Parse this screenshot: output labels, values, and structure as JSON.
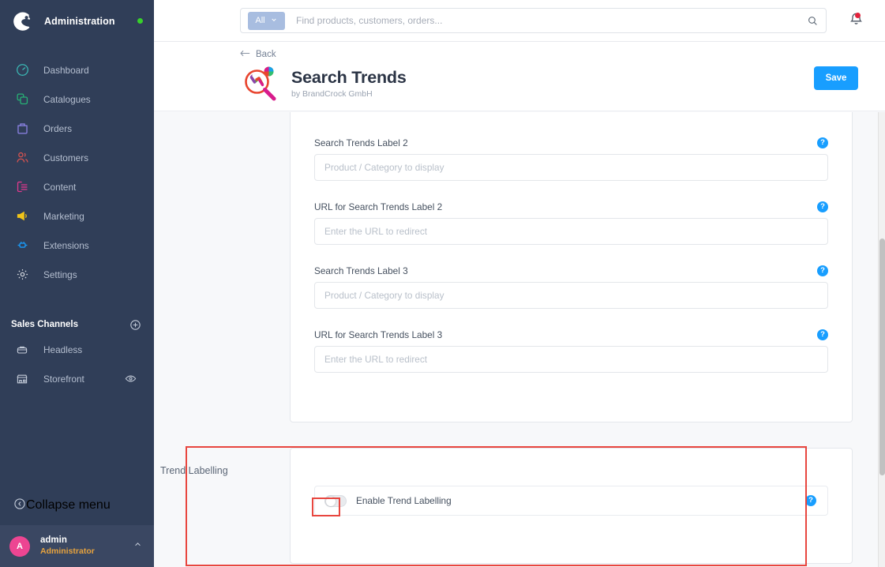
{
  "sidebar": {
    "brand": {
      "title": "Administration",
      "logo_icon": "shopware-logo-icon",
      "status_dot": "online-dot"
    },
    "items": [
      {
        "label": "Dashboard",
        "icon": "speedometer-icon",
        "color": "#3bb6b3"
      },
      {
        "label": "Catalogues",
        "icon": "layers-icon",
        "color": "#27b376"
      },
      {
        "label": "Orders",
        "icon": "bag-icon",
        "color": "#8e84e8"
      },
      {
        "label": "Customers",
        "icon": "users-icon",
        "color": "#d9534f"
      },
      {
        "label": "Content",
        "icon": "content-list-icon",
        "color": "#e0398e"
      },
      {
        "label": "Marketing",
        "icon": "megaphone-icon",
        "color": "#f0c419"
      },
      {
        "label": "Extensions",
        "icon": "plug-icon",
        "color": "#189eff"
      },
      {
        "label": "Settings",
        "icon": "gear-icon",
        "color": "#d8dce3"
      }
    ],
    "sales_channels": {
      "title": "Sales Channels",
      "add_icon": "plus-circle-icon"
    },
    "channels": [
      {
        "label": "Headless",
        "icon": "headless-icon",
        "trailing_icon": ""
      },
      {
        "label": "Storefront",
        "icon": "storefront-icon",
        "trailing_icon": "eye-icon"
      }
    ],
    "collapse": {
      "label": "Collapse menu",
      "icon": "chevron-left-circle-icon"
    },
    "user": {
      "avatar_initial": "A",
      "name": "admin",
      "role": "Administrator",
      "caret_icon": "chevron-up-icon"
    }
  },
  "topbar": {
    "scope_label": "All",
    "scope_caret_icon": "chevron-down-icon",
    "search_placeholder": "Find products, customers, orders...",
    "search_value": "",
    "search_icon": "magnifier-icon",
    "notifications_icon": "bell-icon",
    "notifications_badge": "unread-dot"
  },
  "pagehead": {
    "back_label": "Back",
    "back_icon": "arrow-left-icon",
    "app_logo_icon": "search-trends-magnifier-logo",
    "title": "Search Trends",
    "subtitle": "by BrandCrock GmbH",
    "save_label": "Save"
  },
  "form": {
    "help_icon_glyph": "?",
    "fields": [
      {
        "label": "",
        "placeholder": "Enter the URL to redirect",
        "value": "",
        "has_help": false
      },
      {
        "label": "Search Trends Label 2",
        "placeholder": "Product / Category to display",
        "value": "",
        "has_help": true
      },
      {
        "label": "URL for Search Trends Label 2",
        "placeholder": "Enter the URL to redirect",
        "value": "",
        "has_help": true
      },
      {
        "label": "Search Trends Label 3",
        "placeholder": "Product / Category to display",
        "value": "",
        "has_help": true
      },
      {
        "label": "URL for Search Trends Label 3",
        "placeholder": "Enter the URL to redirect",
        "value": "",
        "has_help": true
      }
    ]
  },
  "trend_labelling": {
    "section_label": "Trend Labelling",
    "toggle_label": "Enable Trend Labelling",
    "toggle_state": "off",
    "has_help": true
  },
  "highlights": {
    "accent_color": "#e8463f"
  }
}
